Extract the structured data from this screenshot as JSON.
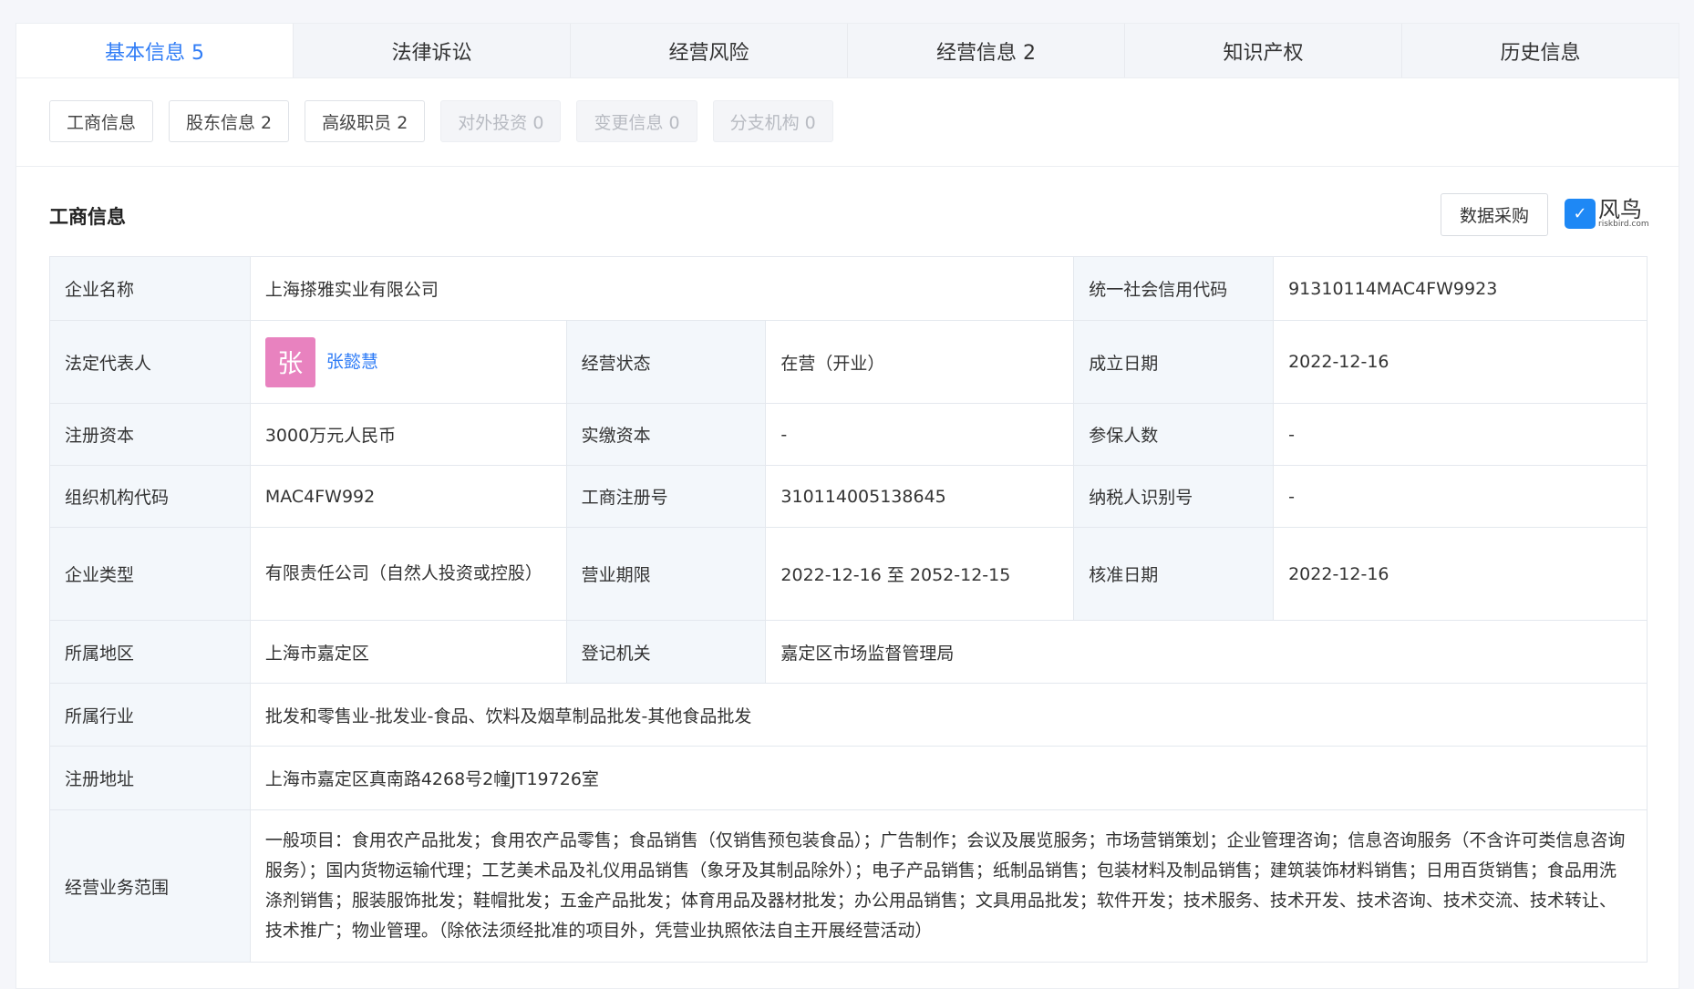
{
  "tabs": [
    "基本信息 5",
    "法律诉讼",
    "经营风险",
    "经营信息 2",
    "知识产权",
    "历史信息"
  ],
  "subtabs": [
    {
      "label": "工商信息",
      "disabled": false
    },
    {
      "label": "股东信息 2",
      "disabled": false
    },
    {
      "label": "高级职员 2",
      "disabled": false
    },
    {
      "label": "对外投资 0",
      "disabled": true
    },
    {
      "label": "变更信息 0",
      "disabled": true
    },
    {
      "label": "分支机构 0",
      "disabled": true
    }
  ],
  "section_title": "工商信息",
  "buy_label": "数据采购",
  "logo": {
    "name": "风鸟",
    "domain": "riskbird.com"
  },
  "info": {
    "company_name_label": "企业名称",
    "company_name": "上海搽雅实业有限公司",
    "credit_code_label": "统一社会信用代码",
    "credit_code": "91310114MAC4FW9923",
    "legal_rep_label": "法定代表人",
    "legal_rep_avatar": "张",
    "legal_rep": "张懿慧",
    "status_label": "经营状态",
    "status": "在营（开业）",
    "founded_label": "成立日期",
    "founded": "2022-12-16",
    "reg_capital_label": "注册资本",
    "reg_capital": "3000万元人民币",
    "paid_capital_label": "实缴资本",
    "paid_capital": "-",
    "insured_label": "参保人数",
    "insured": "-",
    "org_code_label": "组织机构代码",
    "org_code": "MAC4FW992",
    "reg_no_label": "工商注册号",
    "reg_no": "310114005138645",
    "tax_id_label": "纳税人识别号",
    "tax_id": "-",
    "type_label": "企业类型",
    "type": "有限责任公司（自然人投资或控股）",
    "term_label": "营业期限",
    "term": "2022-12-16 至 2052-12-15",
    "approved_label": "核准日期",
    "approved": "2022-12-16",
    "region_label": "所属地区",
    "region": "上海市嘉定区",
    "authority_label": "登记机关",
    "authority": "嘉定区市场监督管理局",
    "industry_label": "所属行业",
    "industry": "批发和零售业-批发业-食品、饮料及烟草制品批发-其他食品批发",
    "address_label": "注册地址",
    "address": "上海市嘉定区真南路4268号2幢JT19726室",
    "scope_label": "经营业务范围",
    "scope": "一般项目：食用农产品批发；食用农产品零售；食品销售（仅销售预包装食品）；广告制作；会议及展览服务；市场营销策划；企业管理咨询；信息咨询服务（不含许可类信息咨询服务）；国内货物运输代理；工艺美术品及礼仪用品销售（象牙及其制品除外）；电子产品销售；纸制品销售；包装材料及制品销售；建筑装饰材料销售；日用百货销售；食品用洗涤剂销售；服装服饰批发；鞋帽批发；五金产品批发；体育用品及器材批发；办公用品销售；文具用品批发；软件开发；技术服务、技术开发、技术咨询、技术交流、技术转让、技术推广；物业管理。（除依法须经批准的项目外，凭营业执照依法自主开展经营活动）"
  }
}
